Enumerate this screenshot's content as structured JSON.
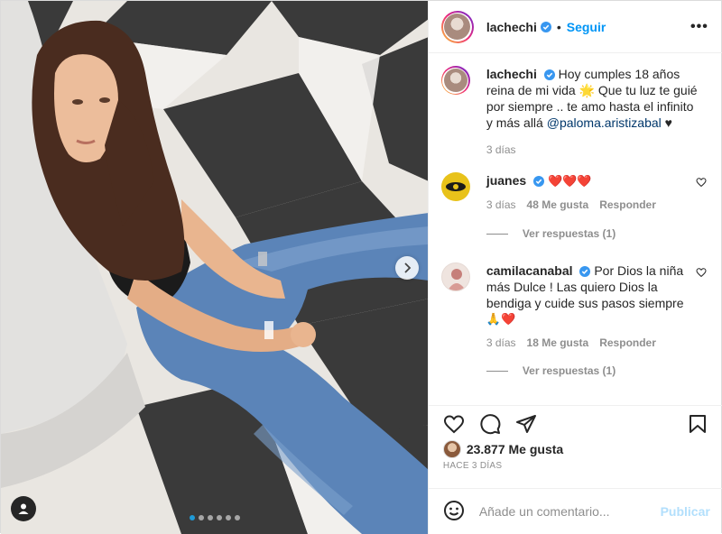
{
  "post": {
    "author": "lachechi",
    "follow_label": "Seguir",
    "more_label": "•••",
    "photo_indicator_count": 6
  },
  "caption": {
    "username": "lachechi",
    "text_before_mention": "Hoy cumples 18 años reina de mi vida 🌟 Que tu luz te guié por siempre .. te amo hasta el infinito y más allá",
    "mention": "@paloma.aristizabal",
    "text_after_mention": "♥",
    "time": "3 días"
  },
  "comments": [
    {
      "username": "juanes",
      "text": "❤️❤️❤️",
      "time": "3 días",
      "likes": "48 Me gusta",
      "reply_label": "Responder",
      "view_replies": "Ver respuestas (1)"
    },
    {
      "username": "camilacanabal",
      "text": "Por Dios la niña más Dulce ! Las quiero Dios la bendiga y cuide sus pasos siempre",
      "emoji_line": "🙏❤️",
      "time": "3 días",
      "likes": "18 Me gusta",
      "reply_label": "Responder",
      "view_replies": "Ver respuestas (1)"
    }
  ],
  "footer": {
    "likes_count": "23.877 Me gusta",
    "posted_ago": "HACE 3 DÍAS",
    "comment_placeholder": "Añade un comentario...",
    "publish_label": "Publicar"
  },
  "icons": {
    "verified": "verified-badge-icon",
    "like": "heart-icon",
    "comment": "comment-bubble-icon",
    "share": "paper-plane-icon",
    "save": "bookmark-icon",
    "emoji": "smiley-icon",
    "next": "chevron-right-icon",
    "tag": "user-tag-icon"
  },
  "colors": {
    "accent": "#0095f6",
    "verified": "#3897f0",
    "heart": "#ed4956",
    "muted": "#8e8e8e"
  }
}
